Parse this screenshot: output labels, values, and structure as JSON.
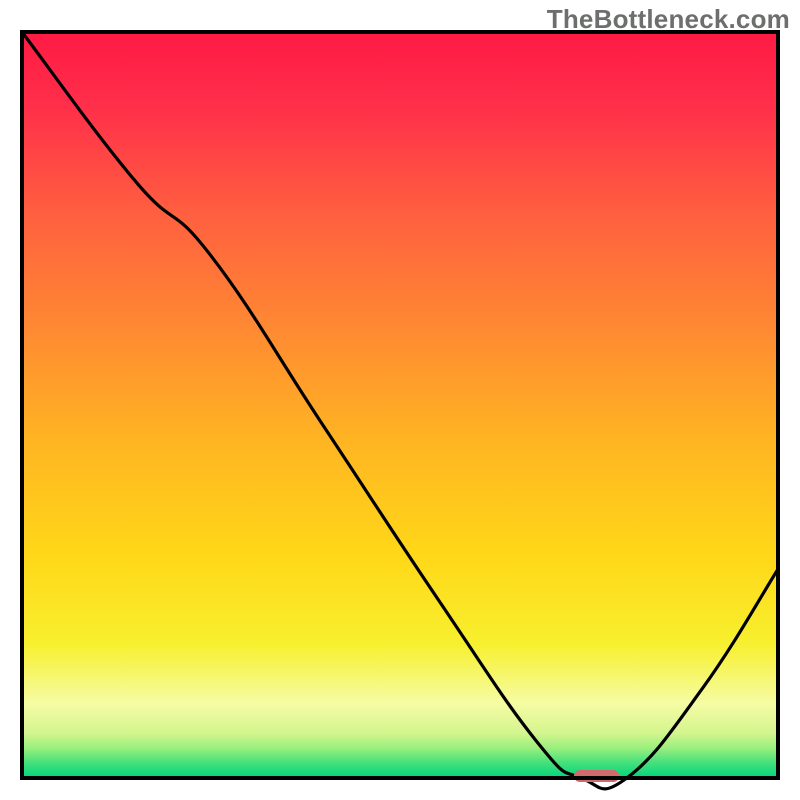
{
  "watermark": "TheBottleneck.com",
  "colors": {
    "border": "#000000",
    "line": "#000000",
    "marker": "#d16a6e",
    "gradient_stops": [
      {
        "offset": 0.0,
        "color": "#ff1a44"
      },
      {
        "offset": 0.1,
        "color": "#ff2f4a"
      },
      {
        "offset": 0.25,
        "color": "#ff613f"
      },
      {
        "offset": 0.4,
        "color": "#ff8a32"
      },
      {
        "offset": 0.55,
        "color": "#ffb522"
      },
      {
        "offset": 0.7,
        "color": "#ffd718"
      },
      {
        "offset": 0.82,
        "color": "#f7f02e"
      },
      {
        "offset": 0.9,
        "color": "#f6fca4"
      },
      {
        "offset": 0.94,
        "color": "#d3f58e"
      },
      {
        "offset": 0.96,
        "color": "#9aef7e"
      },
      {
        "offset": 0.98,
        "color": "#42e07b"
      },
      {
        "offset": 1.0,
        "color": "#00d57b"
      }
    ]
  },
  "chart_data": {
    "type": "line",
    "title": "",
    "xlabel": "",
    "ylabel": "",
    "xlim": [
      0,
      1
    ],
    "ylim": [
      0,
      1
    ],
    "series": [
      {
        "name": "curve",
        "x": [
          0.0,
          0.15,
          0.25,
          0.4,
          0.55,
          0.68,
          0.74,
          0.8,
          0.9,
          1.0
        ],
        "y": [
          1.0,
          0.8,
          0.7,
          0.47,
          0.24,
          0.05,
          0.0,
          0.0,
          0.12,
          0.28
        ]
      }
    ],
    "marker": {
      "x": 0.76,
      "y": 0.0,
      "width": 0.06
    }
  }
}
